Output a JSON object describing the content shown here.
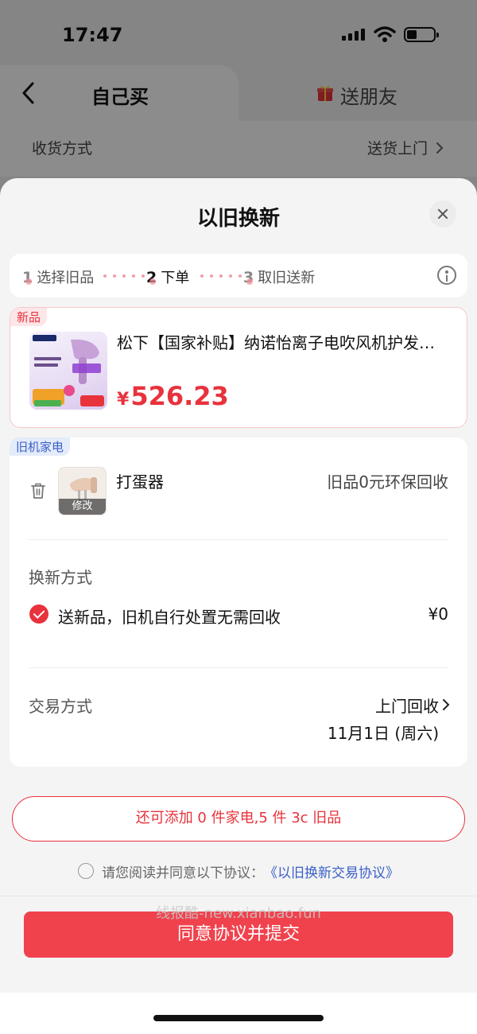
{
  "status_bar": {
    "time": "17:47"
  },
  "top_tabs": {
    "self_buy": "自己买",
    "send_friend": "送朋友"
  },
  "delivery": {
    "label": "收货方式",
    "value": "送货上门"
  },
  "sheet": {
    "title": "以旧换新",
    "steps": [
      {
        "num": "1",
        "label": "选择旧品"
      },
      {
        "num": "2",
        "label": "下单"
      },
      {
        "num": "3",
        "label": "取旧送新"
      }
    ],
    "new_item": {
      "tag": "新品",
      "name": "松下【国家补贴】纳诺怡离子电吹风机护发…",
      "price_currency": "¥",
      "price": "526.23"
    },
    "old_item": {
      "tag": "旧机家电",
      "name": "打蛋器",
      "edit_label": "修改",
      "recycle_text": "旧品0元环保回收"
    },
    "exchange_method": {
      "label": "换新方式",
      "option_text": "送新品，旧机自行处置无需回收",
      "option_price": "¥0"
    },
    "trade_method": {
      "label": "交易方式",
      "value": "上门回收",
      "date": "11月1日 (周六)"
    },
    "add_more": "还可添加 0 件家电,5 件 3c 旧品",
    "agreement": {
      "text": "请您阅读并同意以下协议：",
      "link": "《以旧换新交易协议》"
    },
    "watermark": "线报酷-new.xianbao.fun",
    "submit": "同意协议并提交"
  },
  "colors": {
    "accent": "#e8323c",
    "button": "#f0424d",
    "link": "#3a5fc8"
  }
}
